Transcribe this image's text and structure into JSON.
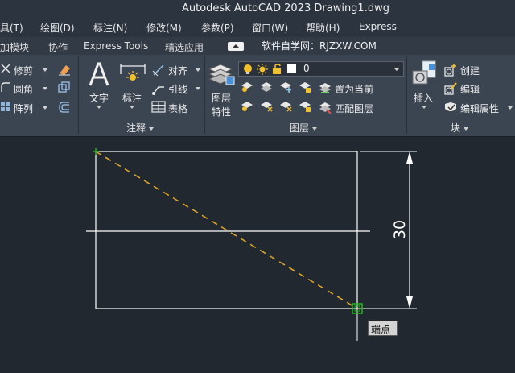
{
  "window": {
    "title": "Autodesk AutoCAD 2023    Drawing1.dwg"
  },
  "menu": {
    "items": [
      "具(T)",
      "绘图(D)",
      "标注(N)",
      "修改(M)",
      "参数(P)",
      "窗口(W)",
      "帮助(H)",
      "Express"
    ]
  },
  "tabs": {
    "items": [
      "加模块",
      "协作",
      "Express Tools",
      "精选应用"
    ]
  },
  "watermark": "软件自学网：RJZXW.COM",
  "ribbon": {
    "modify": {
      "trim": "修剪",
      "fillet": "圆角",
      "array": "阵列"
    },
    "annotation": {
      "title": "注释",
      "text": "文字",
      "dimension": "标注",
      "align": "对齐",
      "leader": "引线",
      "table": "表格"
    },
    "layers": {
      "title": "图层",
      "properties_line1": "图层",
      "properties_line2": "特性",
      "current_layer": "0",
      "set_current": "置为当前",
      "match_layer": "匹配图层"
    },
    "block": {
      "title": "块",
      "insert": "插入",
      "create": "创建",
      "edit": "编辑",
      "edit_attributes": "编辑属性"
    }
  },
  "drawing": {
    "dimension_value": "30",
    "snap_tooltip": "端点"
  },
  "colors": {
    "canvas_background": "#212830",
    "ribbon_background": "#3b4451",
    "geometry_line": "#ffffff",
    "dashed_line": "#e0a829",
    "snap_marker": "#22b022"
  }
}
